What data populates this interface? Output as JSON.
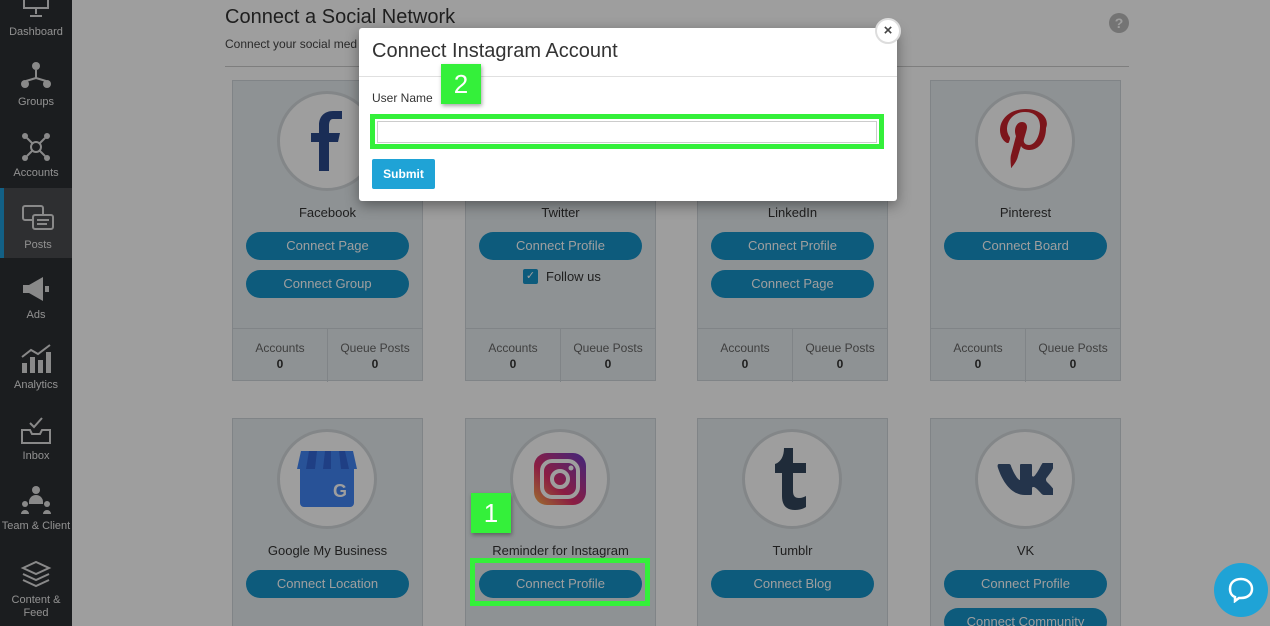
{
  "sidebar": {
    "items": [
      {
        "label": "Dashboard",
        "icon": "monitor-icon"
      },
      {
        "label": "Groups",
        "icon": "groups-icon"
      },
      {
        "label": "Accounts",
        "icon": "network-icon"
      },
      {
        "label": "Posts",
        "icon": "posts-icon"
      },
      {
        "label": "Ads",
        "icon": "megaphone-icon"
      },
      {
        "label": "Analytics",
        "icon": "chart-icon"
      },
      {
        "label": "Inbox",
        "icon": "inbox-icon"
      },
      {
        "label": "Team & Client",
        "icon": "team-icon"
      },
      {
        "label": "Content & Feed",
        "icon": "layers-icon"
      }
    ],
    "active": "Posts",
    "accent": "#1e9bd7"
  },
  "page": {
    "title": "Connect a Social Network",
    "subtitle": "Connect your social med"
  },
  "stat_labels": {
    "accounts": "Accounts",
    "queue": "Queue Posts"
  },
  "cards": {
    "facebook": {
      "name": "Facebook",
      "btn1": "Connect Page",
      "btn2": "Connect Group",
      "accounts": "0",
      "queue": "0"
    },
    "twitter": {
      "name": "Twitter",
      "btn1": "Connect Profile",
      "follow": "Follow us",
      "accounts": "0",
      "queue": "0"
    },
    "linkedin": {
      "name": "LinkedIn",
      "btn1": "Connect Profile",
      "btn2": "Connect Page",
      "accounts": "0",
      "queue": "0"
    },
    "pinterest": {
      "name": "Pinterest",
      "btn1": "Connect Board",
      "accounts": "0",
      "queue": "0"
    },
    "google": {
      "name": "Google My Business",
      "btn1": "Connect Location"
    },
    "instagram": {
      "name": "Reminder for Instagram",
      "btn1": "Connect Profile"
    },
    "tumblr": {
      "name": "Tumblr",
      "btn1": "Connect Blog"
    },
    "vk": {
      "name": "VK",
      "btn1": "Connect Profile",
      "btn2": "Connect Community"
    }
  },
  "modal": {
    "title": "Connect Instagram Account",
    "field_label": "User Name",
    "username_value": "",
    "submit": "Submit",
    "close": "×"
  },
  "annotations": {
    "step1": "1",
    "step2": "2"
  },
  "colors": {
    "primary": "#1693c9",
    "highlight": "#34f03a",
    "sidebar": "#2d2f32"
  }
}
